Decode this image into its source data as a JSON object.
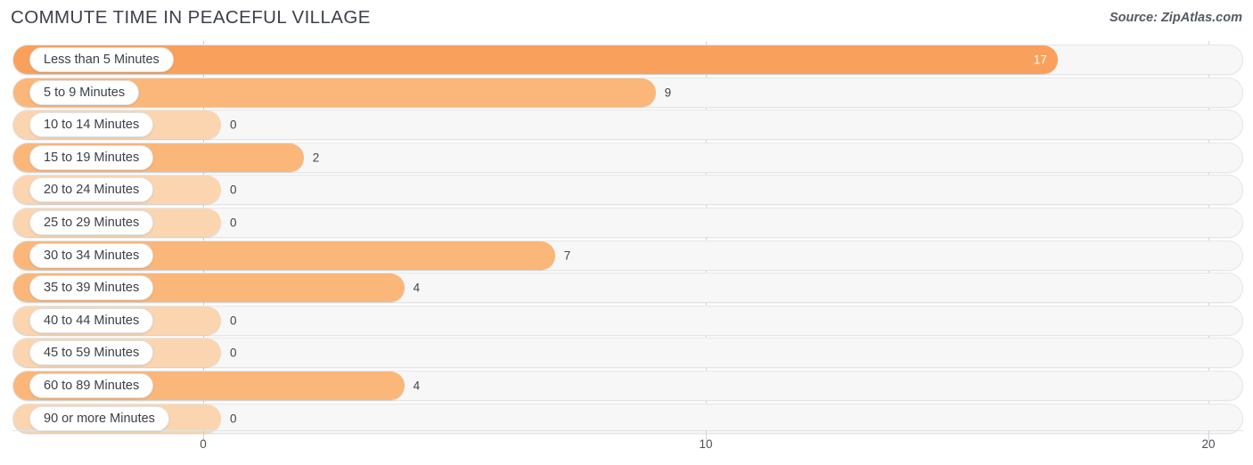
{
  "header": {
    "title": "COMMUTE TIME IN PEACEFUL VILLAGE",
    "source": "Source: ZipAtlas.com"
  },
  "colors": {
    "bar_high": "#f9a15c",
    "bar_mid": "#fbb679",
    "bar_zero": "#fbd5b0",
    "track": "#f7f7f7",
    "gridline": "#d8d8d8",
    "text": "#3b3f46",
    "value_inside": "#ffffff"
  },
  "chart_data": {
    "type": "bar",
    "orientation": "horizontal",
    "title": "COMMUTE TIME IN PEACEFUL VILLAGE",
    "subtitle": "Source: ZipAtlas.com",
    "xlabel": "",
    "ylabel": "",
    "xlim": [
      0,
      20
    ],
    "grid": true,
    "legend": null,
    "xticks": [
      0,
      10,
      20
    ],
    "xtick_labels": [
      "0",
      "10",
      "20"
    ],
    "categories": [
      "Less than 5 Minutes",
      "5 to 9 Minutes",
      "10 to 14 Minutes",
      "15 to 19 Minutes",
      "20 to 24 Minutes",
      "25 to 29 Minutes",
      "30 to 34 Minutes",
      "35 to 39 Minutes",
      "40 to 44 Minutes",
      "45 to 59 Minutes",
      "60 to 89 Minutes",
      "90 or more Minutes"
    ],
    "values": [
      17,
      9,
      0,
      2,
      0,
      0,
      7,
      4,
      0,
      0,
      4,
      0
    ],
    "value_labels": [
      "17",
      "9",
      "0",
      "2",
      "0",
      "0",
      "7",
      "4",
      "0",
      "0",
      "4",
      "0"
    ]
  }
}
